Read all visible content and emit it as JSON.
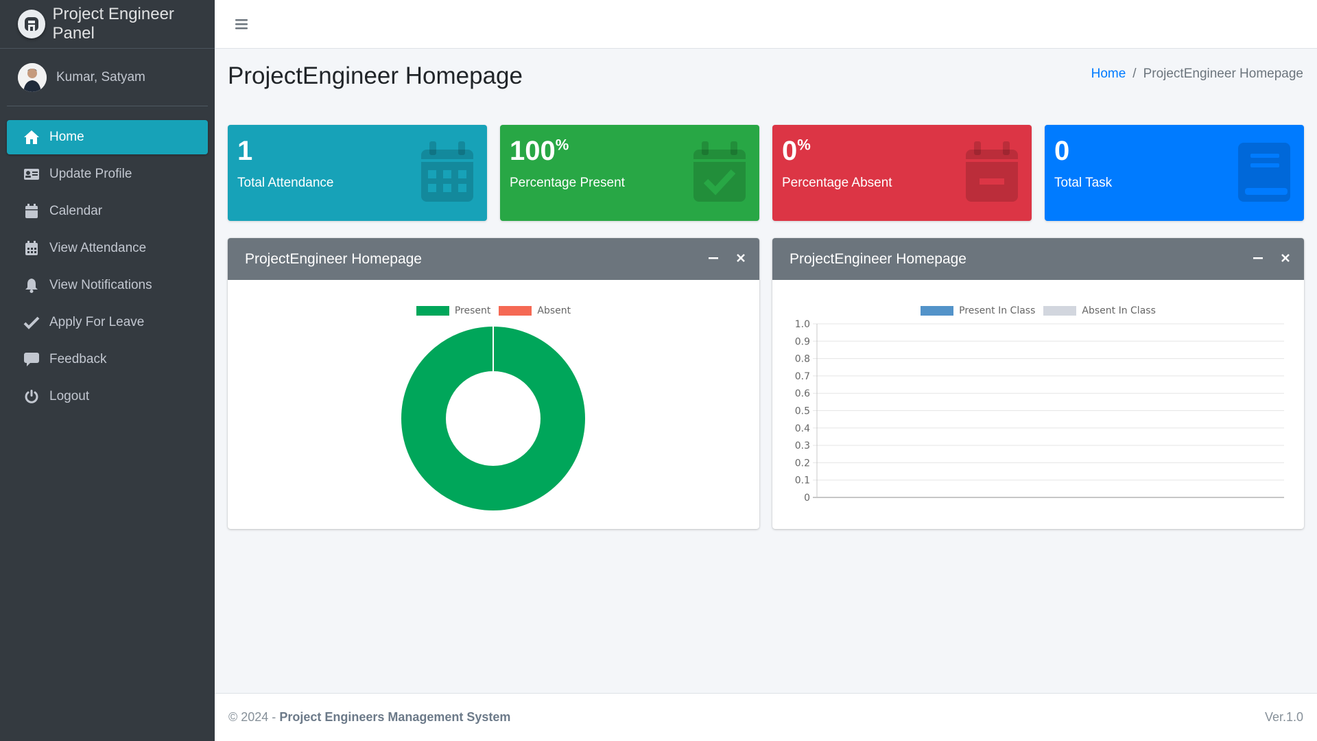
{
  "brand": {
    "title": "Project Engineer Panel"
  },
  "user": {
    "name": "Kumar, Satyam"
  },
  "sidebar": {
    "items": [
      {
        "label": "Home",
        "icon": "home-icon",
        "active": true
      },
      {
        "label": "Update Profile",
        "icon": "id-card-icon"
      },
      {
        "label": "Calendar",
        "icon": "calendar-icon"
      },
      {
        "label": "View Attendance",
        "icon": "calendar-grid-icon"
      },
      {
        "label": "View Notifications",
        "icon": "bell-icon"
      },
      {
        "label": "Apply For Leave",
        "icon": "check-icon"
      },
      {
        "label": "Feedback",
        "icon": "comment-icon"
      },
      {
        "label": "Logout",
        "icon": "power-icon"
      }
    ]
  },
  "page": {
    "title": "ProjectEngineer Homepage",
    "breadcrumb": {
      "home": "Home",
      "separator": "/",
      "current": "ProjectEngineer Homepage"
    }
  },
  "stats": [
    {
      "value": "1",
      "suffix": "",
      "label": "Total Attendance",
      "color": "#17a2b8",
      "icon": "calendar-icon"
    },
    {
      "value": "100",
      "suffix": "%",
      "label": "Percentage Present",
      "color": "#28a745",
      "icon": "calendar-check-icon"
    },
    {
      "value": "0",
      "suffix": "%",
      "label": "Percentage Absent",
      "color": "#dc3545",
      "icon": "calendar-minus-icon"
    },
    {
      "value": "0",
      "suffix": "",
      "label": "Total Task",
      "color": "#007bff",
      "icon": "book-icon"
    }
  ],
  "cards": [
    {
      "title": "ProjectEngineer Homepage"
    },
    {
      "title": "ProjectEngineer Homepage"
    }
  ],
  "chart_data": [
    {
      "type": "pie",
      "variant": "doughnut",
      "labels": [
        "Present",
        "Absent"
      ],
      "values": [
        1,
        0
      ],
      "colors": [
        "#00a65a",
        "#f56954"
      ],
      "legend": "top"
    },
    {
      "type": "bar",
      "series": [
        {
          "name": "Present In Class",
          "values": [],
          "color": "#5393c9"
        },
        {
          "name": "Absent In Class",
          "values": [],
          "color": "#d2d6de"
        }
      ],
      "categories": [],
      "ylim": [
        0,
        1
      ],
      "yticks": [
        "1.0",
        "0.9",
        "0.8",
        "0.7",
        "0.6",
        "0.5",
        "0.4",
        "0.3",
        "0.2",
        "0.1",
        "0"
      ],
      "grid": true,
      "legend": "top"
    }
  ],
  "footer": {
    "copyright": "© 2024 -",
    "system": "Project Engineers Management System",
    "version": "Ver.1.0"
  }
}
